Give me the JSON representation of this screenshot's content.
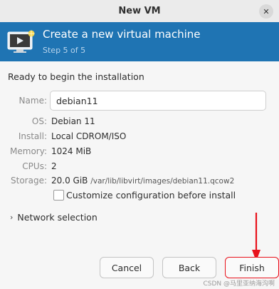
{
  "window": {
    "title": "New VM",
    "close_glyph": "✕"
  },
  "banner": {
    "title": "Create a new virtual machine",
    "step": "Step 5 of 5",
    "color": "#1f74b3",
    "icon": "vm-monitor-icon"
  },
  "summary": {
    "heading": "Ready to begin the installation",
    "name_label": "Name:",
    "name_value": "debian11",
    "os_label": "OS:",
    "os_value": "Debian 11",
    "install_label": "Install:",
    "install_value": "Local CDROM/ISO",
    "memory_label": "Memory:",
    "memory_value": "1024 MiB",
    "cpus_label": "CPUs:",
    "cpus_value": "2",
    "storage_label": "Storage:",
    "storage_size": "20.0 GiB",
    "storage_path": "/var/lib/libvirt/images/debian11.qcow2"
  },
  "customize": {
    "label": "Customize configuration before install",
    "checked": false
  },
  "network": {
    "label": "Network selection",
    "chevron": "›"
  },
  "buttons": {
    "cancel": "Cancel",
    "back": "Back",
    "finish": "Finish"
  },
  "annotation": {
    "arrow_color": "#e8121c"
  },
  "watermark": "CSDN @马里亚纳海沟啊"
}
